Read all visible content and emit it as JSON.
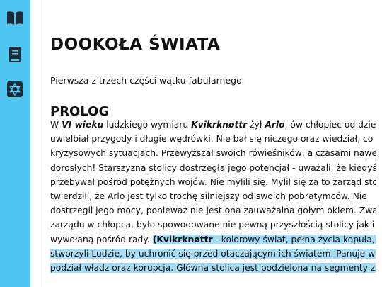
{
  "sidebar": {
    "items": [
      {
        "icon": "open-book-icon"
      },
      {
        "icon": "book-icon"
      },
      {
        "icon": "star-of-david-icon"
      }
    ]
  },
  "article": {
    "title": "DOOKOŁA ŚWIATA",
    "subtitle": "Pierwsza z trzech części wątku fabularnego.",
    "section_title": "PROLOG",
    "line1": {
      "a": "W ",
      "b": "VI wieku",
      "c": " ludzkiego wymiaru ",
      "d": "Kvikrknøttr",
      "e": " żył ",
      "f": "Arlo",
      "g": ", ów chłopiec od dzieciaka"
    },
    "lines": [
      "uwielbiał przygody i długie wędrówki. Nie bał się niczego oraz wiedział, co robić w",
      "kryzysowych sytuacjach. Przewyższał swoich rówieśników, a czasami nawet",
      "dorosłych! Starszyzna stolicy dostrzegła jego potencjał - uważali, że kiedyś będzie",
      "przebywał pośród potężnych wojów. Nie mylili się. Mylił się za to zarząd stolicy,",
      "twierdzili, że Arlo jest tylko trochę silniejszy od swoich pobratymców. Nie",
      "dostrzegli jego mocy, ponieważ nie jest ona zauważalna gołym okiem. Zwątpienie",
      "zarządu w chłopca, było spowodowane nie pewną przyszłością stolicy jak i korupcją"
    ],
    "line9": {
      "a": "wywołaną pośród rady. ",
      "b": "(",
      "c": "Kvikrknøttr",
      "d": " - kolorowy świat, pełna życia kopuła, którą"
    },
    "line10": "stworzyli Ludzie, by uchronić się przed otaczającym ich światem. Panuje w niej",
    "line11": "podział władz oraz korupcja. Główna stolica jest podzielona na segmenty zamożności,"
  }
}
